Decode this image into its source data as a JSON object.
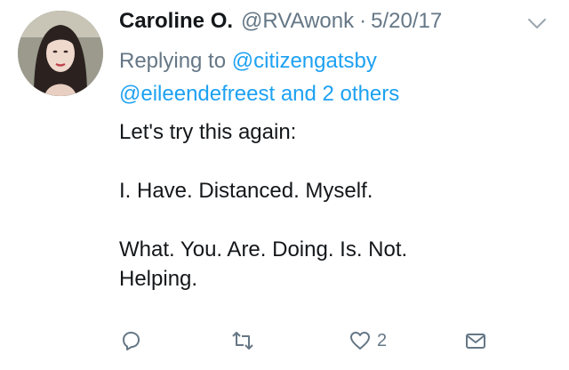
{
  "tweet": {
    "author_name": "Caroline O.",
    "author_handle": "@RVAwonk",
    "separator": "·",
    "date": "5/20/17",
    "replying_prefix": "Replying to",
    "reply_mention_1": "@citizengatsby",
    "reply_mention_2": "@eileendefreest",
    "reply_and": "and",
    "reply_others": "2 others",
    "body_lines": [
      "Let's try this again:",
      "I. Have. Distanced. Myself.",
      "What. You. Are. Doing. Is. Not.",
      "Helping."
    ]
  },
  "actions": {
    "reply_icon": "reply-icon",
    "retweet_icon": "retweet-icon",
    "like_icon": "heart-icon",
    "like_count": "2",
    "dm_icon": "envelope-icon"
  },
  "colors": {
    "text": "#14171a",
    "muted": "#657786",
    "link": "#1da1f2"
  }
}
